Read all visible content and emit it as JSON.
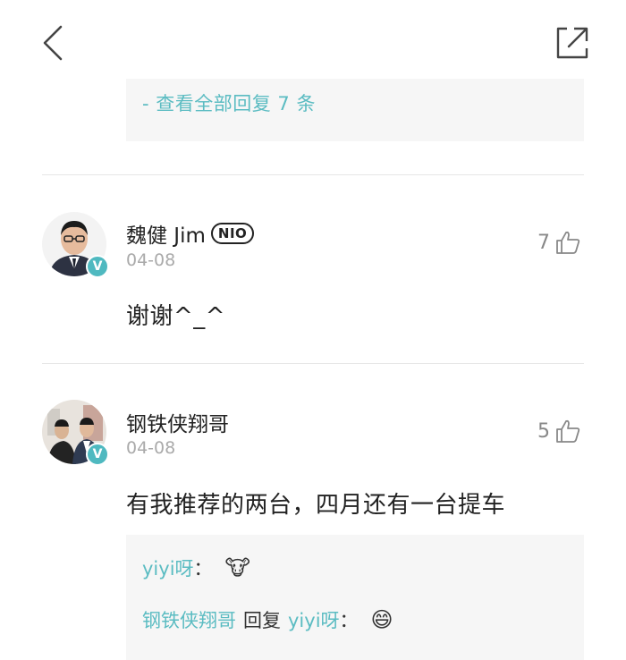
{
  "header": {
    "back_icon": "chevron-left-icon",
    "share_icon": "share-icon"
  },
  "top_reply_box": {
    "view_all": "- 查看全部回复 7 条"
  },
  "comments": [
    {
      "username": "魏健 Jim",
      "badge": "NIO",
      "date": "04-08",
      "likes": "7",
      "text": "谢谢^_^",
      "verified": "V"
    },
    {
      "username": "钢铁侠翔哥",
      "date": "04-08",
      "likes": "5",
      "text": "有我推荐的两台，四月还有一台提车",
      "verified": "V"
    }
  ],
  "replies": [
    {
      "user": "yiyi呀",
      "sep": "：",
      "emoji": "🐮"
    },
    {
      "user": "钢铁侠翔哥",
      "action": "回复",
      "target": "yiyi呀",
      "sep": "：",
      "emoji": "😄"
    }
  ],
  "colors": {
    "accent": "#5bbcc2",
    "verified": "#4fb9c0"
  }
}
